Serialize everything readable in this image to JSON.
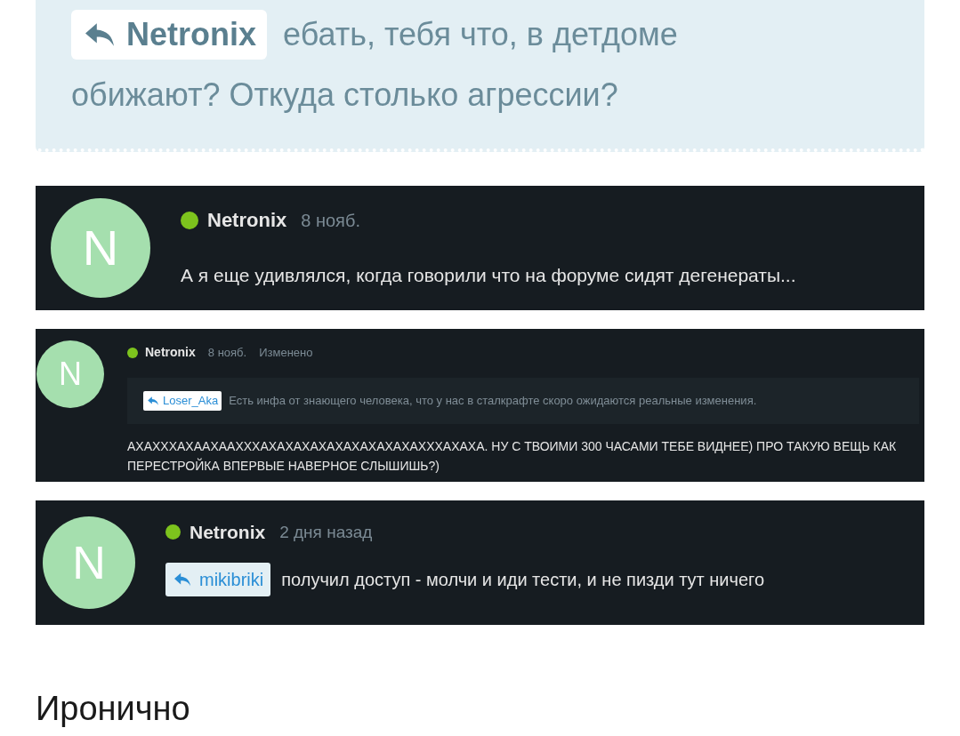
{
  "quote": {
    "reply_to": "Netronix",
    "lines": [
      "ебать, тебя что, в детдоме",
      "обижают? Откуда столько агрессии?"
    ]
  },
  "comments": [
    {
      "kind": "plain",
      "avatar": "N",
      "author": "Netronix",
      "online": true,
      "date": "8 нояб.",
      "text": "А я еще удивлялся, когда говорили что на форуме сидят дегенераты..."
    },
    {
      "kind": "quoted",
      "avatar": "N",
      "author": "Netronix",
      "online": true,
      "date": "8 нояб.",
      "edited": "Изменено",
      "quote_author": "Loser_Aka",
      "quote_text": "Есть инфа от знающего человека, что у нас в сталкрафте скоро ожидаются реальные изменения.",
      "text": "АХАХХХАХААХААХХХАХАХАХАХАХАХАХАХАХАХХХАХАХА. НУ С ТВОИМИ 300 ЧАСАМИ ТЕБЕ ВИДНЕЕ) ПРО ТАКУЮ ВЕЩЬ КАК ПЕРЕСТРОЙКА ВПЕРВЫЕ НАВЕРНОЕ СЛЫШИШЬ?)"
    },
    {
      "kind": "reply",
      "avatar": "N",
      "author": "Netronix",
      "online": true,
      "date": "2 дня назад",
      "reply_to": "mikibriki",
      "text": "получил доступ - молчи и иди тести, и не пизди тут ничего"
    }
  ],
  "heading": "Иронично"
}
